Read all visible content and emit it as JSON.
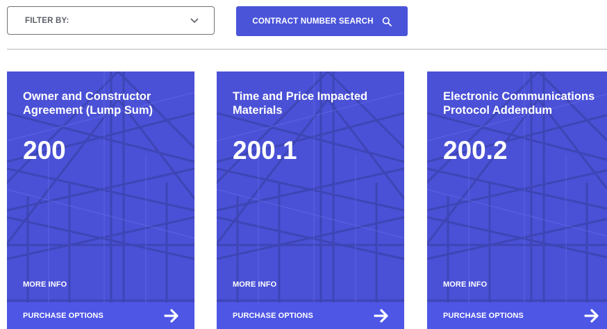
{
  "toolbar": {
    "filter_label": "FILTER BY:",
    "filter_icon": "chevron-down-icon",
    "search_label": "CONTRACT NUMBER SEARCH",
    "search_icon": "search-icon"
  },
  "colors": {
    "accent": "#4a54d9",
    "card_bg": "#4a51d6",
    "card_footer": "#4e56e6",
    "divider": "#d9d9d9"
  },
  "cards": [
    {
      "title": "Owner and Constructor Agreement (Lump Sum)",
      "number": "200",
      "more_info": "MORE INFO",
      "purchase": "PURCHASE OPTIONS",
      "purchase_icon": "arrow-right-icon"
    },
    {
      "title": "Time and Price Impacted Materials",
      "number": "200.1",
      "more_info": "MORE INFO",
      "purchase": "PURCHASE OPTIONS",
      "purchase_icon": "arrow-right-icon"
    },
    {
      "title": "Electronic Communications Protocol Addendum",
      "number": "200.2",
      "more_info": "MORE INFO",
      "purchase": "PURCHASE OPTIONS",
      "purchase_icon": "arrow-right-icon"
    }
  ]
}
